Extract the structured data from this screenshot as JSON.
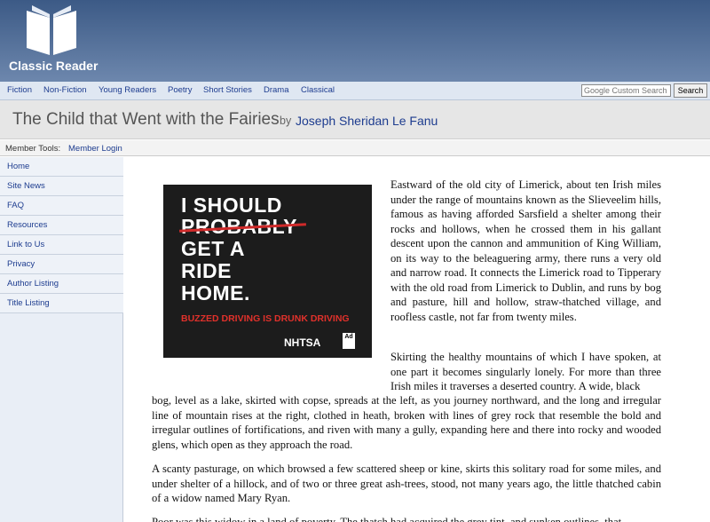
{
  "header": {
    "logo_text": "Classic Reader"
  },
  "nav": {
    "items": [
      "Fiction",
      "Non-Fiction",
      "Young Readers",
      "Poetry",
      "Short Stories",
      "Drama",
      "Classical"
    ],
    "search_placeholder": "Google Custom Search",
    "search_button": "Search"
  },
  "title_bar": {
    "title": "The Child that Went with the Fairies",
    "by": "by",
    "author": "Joseph Sheridan Le Fanu"
  },
  "member_bar": {
    "label": "Member Tools:",
    "login": "Member Login"
  },
  "sidebar": {
    "items": [
      "Home",
      "Site News",
      "FAQ",
      "Resources",
      "Link to Us",
      "Privacy",
      "Author Listing",
      "Title Listing"
    ]
  },
  "ad": {
    "line1": "I SHOULD",
    "line2": "PROBABLY",
    "line3": "GET A",
    "line4": "RIDE",
    "line5": "HOME.",
    "tagline": "BUZZED DRIVING IS DRUNK DRIVING",
    "brand": "NHTSA",
    "logo": "Ad Council"
  },
  "content": {
    "p1": "Eastward of the old city of Limerick, about ten Irish miles under the range of mountains known as the Slieveelim hills, famous as having afforded Sarsfield a shelter among their rocks and hollows, when he crossed them in his gallant descent upon the cannon and ammunition of King William, on its way to the beleaguering army, there runs a very old and narrow road. It connects the Limerick road to Tipperary with the old road from Limerick to Dublin, and runs by bog and pasture, hill and hollow, straw-thatched village, and roofless castle, not far from twenty miles.",
    "p2a": "Skirting the healthy mountains of which I have spoken, at one part it becomes singularly lonely. For more than three Irish miles it traverses a deserted country. A wide, black",
    "p2b": "bog, level as a lake, skirted with copse, spreads at the left, as you journey northward, and the long and irregular line of mountain rises at the right, clothed in heath, broken with lines of grey rock that resemble the bold and irregular outlines of fortifications, and riven with many a gully, expanding here and there into rocky and wooded glens, which open as they approach the road.",
    "p3": "A scanty pasturage, on which browsed a few scattered sheep or kine, skirts this solitary road for some miles, and under shelter of a hillock, and of two or three great ash-trees, stood, not many years ago, the little thatched cabin of a widow named Mary Ryan.",
    "p4": "Poor was this widow in a land of poverty. The thatch had acquired the grey tint, and sunken outlines, that"
  }
}
